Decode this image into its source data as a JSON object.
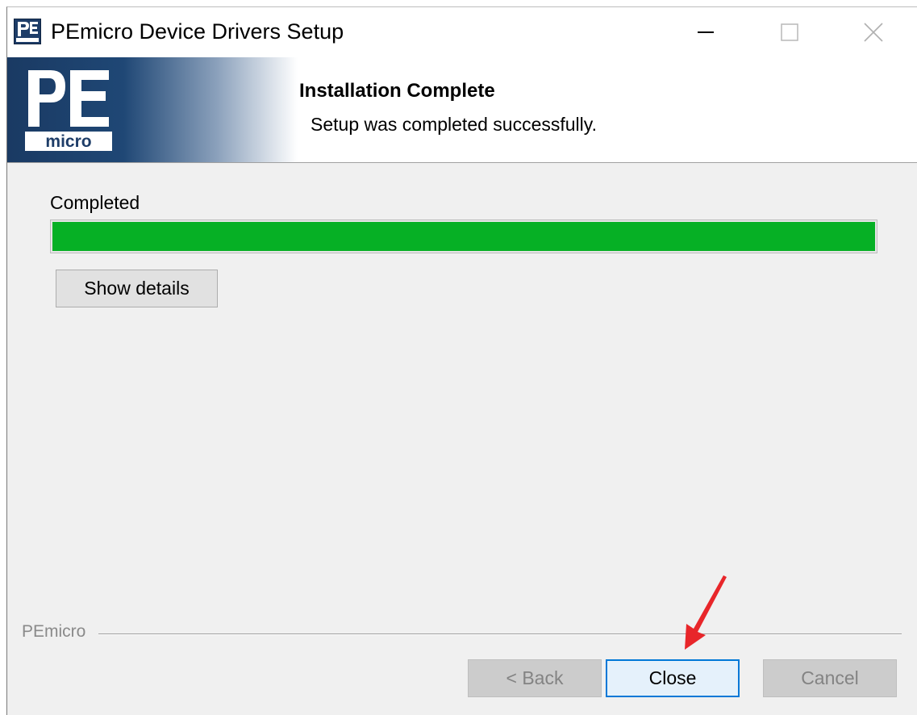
{
  "window": {
    "title": "PEmicro Device Drivers Setup",
    "icon": "pemicro-app-icon",
    "controls": {
      "minimize": "minimize-icon",
      "maximize": "maximize-icon",
      "close": "close-icon"
    }
  },
  "banner": {
    "logo": "PE micro",
    "title": "Installation Complete",
    "subtitle": "Setup was completed successfully."
  },
  "progress": {
    "label": "Completed",
    "value": 1.0,
    "color": "#06b025"
  },
  "details_button": "Show details",
  "footer": {
    "brand": "PEmicro",
    "buttons": {
      "back": "< Back",
      "close": "Close",
      "cancel": "Cancel"
    }
  },
  "annotation": {
    "icon": "red-arrow-icon",
    "color": "#e8262a"
  }
}
